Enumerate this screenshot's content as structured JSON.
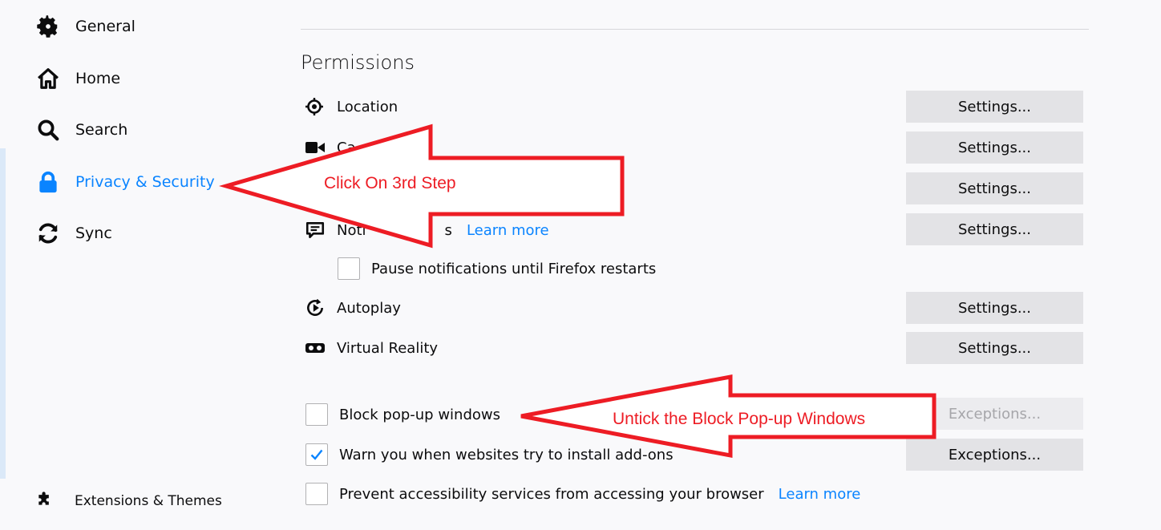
{
  "sidebar": {
    "items": [
      {
        "label": "General",
        "icon": "gear-icon"
      },
      {
        "label": "Home",
        "icon": "home-icon"
      },
      {
        "label": "Search",
        "icon": "search-icon"
      },
      {
        "label": "Privacy & Security",
        "icon": "lock-icon",
        "selected": true
      },
      {
        "label": "Sync",
        "icon": "sync-icon"
      }
    ],
    "extensions_label": "Extensions & Themes"
  },
  "permissions": {
    "title": "Permissions",
    "rows": [
      {
        "label": "Location",
        "button": "Settings..."
      },
      {
        "label": "Ca",
        "button": "Settings..."
      },
      {
        "label": "",
        "button": "Settings..."
      },
      {
        "label": "Noti",
        "label_tail": "s",
        "link": "Learn more",
        "button": "Settings..."
      }
    ],
    "pause_notifications": "Pause notifications until Firefox restarts",
    "autoplay": {
      "label": "Autoplay",
      "button": "Settings..."
    },
    "virtual_reality": {
      "label": "Virtual Reality",
      "button": "Settings..."
    }
  },
  "popups": {
    "block_label": "Block pop-up windows",
    "block_checked": false,
    "block_button": "Exceptions...",
    "warn_label": "Warn you when websites try to install add-ons",
    "warn_checked": true,
    "warn_button": "Exceptions...",
    "prevent_label": "Prevent accessibility services from accessing your browser",
    "prevent_link": "Learn more"
  },
  "annotations": {
    "arrow1_text": "Click On 3rd Step",
    "arrow2_text": "Untick the Block Pop-up Windows",
    "color": "#ed1c24"
  },
  "colors": {
    "accent": "#0a84ff",
    "button_bg": "#e3e3e6"
  }
}
